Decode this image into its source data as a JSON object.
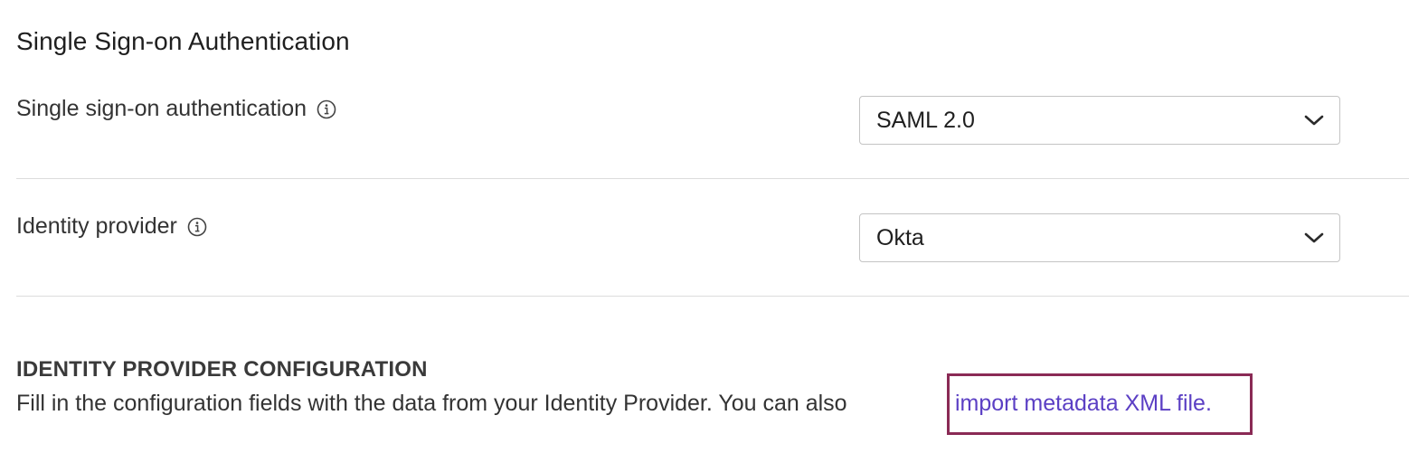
{
  "section": {
    "title": "Single Sign-on Authentication"
  },
  "sso": {
    "label": "Single sign-on authentication",
    "selected": "SAML 2.0"
  },
  "idp": {
    "label": "Identity provider",
    "selected": "Okta"
  },
  "config": {
    "heading": "IDENTITY PROVIDER CONFIGURATION",
    "description": "Fill in the configuration fields with the data from your Identity Provider. You can also",
    "link_text": "import metadata XML file."
  },
  "colors": {
    "link": "#5b3fc4",
    "highlight_border": "#8a2a55",
    "divider": "#dcdcdc"
  },
  "icons": {
    "info": "info-icon",
    "dropdown": "chevron-down-icon"
  }
}
